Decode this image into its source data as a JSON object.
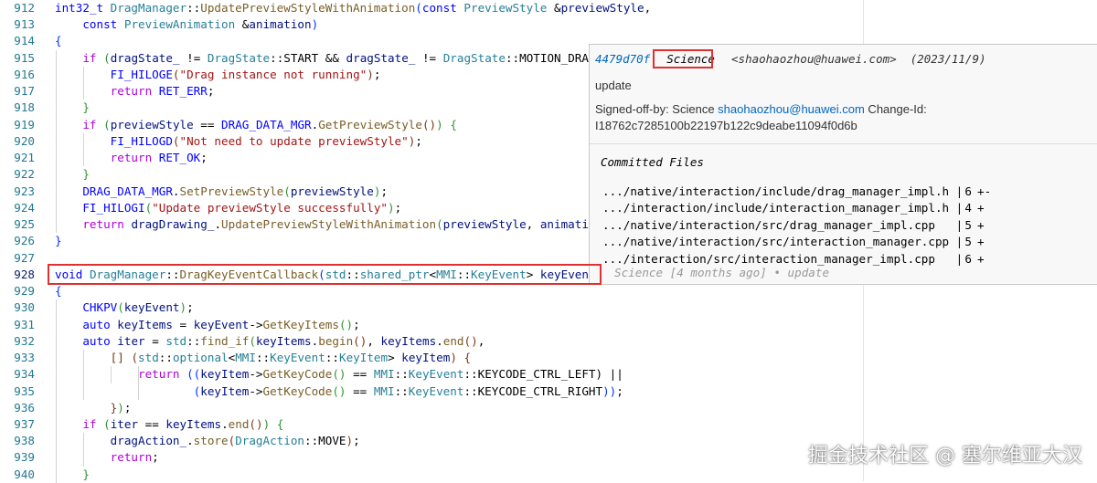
{
  "editor": {
    "lines": [
      {
        "n": "912",
        "tokens": [
          [
            "t-kw",
            "int32_t"
          ],
          [
            "t-plain",
            " "
          ],
          [
            "t-type",
            "DragManager"
          ],
          [
            "t-plain",
            "::"
          ],
          [
            "t-fn",
            "UpdatePreviewStyleWithAnimation"
          ],
          [
            "t-br1",
            "("
          ],
          [
            "t-kw",
            "const"
          ],
          [
            "t-plain",
            " "
          ],
          [
            "t-type",
            "PreviewStyle"
          ],
          [
            "t-plain",
            " &"
          ],
          [
            "t-var",
            "previewStyle"
          ],
          [
            "t-plain",
            ","
          ]
        ]
      },
      {
        "n": "913",
        "tokens": [
          [
            "t-plain",
            "    "
          ],
          [
            "t-kw",
            "const"
          ],
          [
            "t-plain",
            " "
          ],
          [
            "t-type",
            "PreviewAnimation"
          ],
          [
            "t-plain",
            " &"
          ],
          [
            "t-var",
            "animation"
          ],
          [
            "t-br1",
            ")"
          ]
        ]
      },
      {
        "n": "914",
        "tokens": [
          [
            "t-br1",
            "{"
          ]
        ]
      },
      {
        "n": "915",
        "tokens": [
          [
            "t-plain",
            "    "
          ],
          [
            "t-ctrl",
            "if"
          ],
          [
            "t-plain",
            " "
          ],
          [
            "t-br2",
            "("
          ],
          [
            "t-var",
            "dragState_"
          ],
          [
            "t-plain",
            " != "
          ],
          [
            "t-type",
            "DragState"
          ],
          [
            "t-plain",
            "::START && "
          ],
          [
            "t-var",
            "dragState_"
          ],
          [
            "t-plain",
            " != "
          ],
          [
            "t-type",
            "DragState"
          ],
          [
            "t-plain",
            "::MOTION_DRAGG"
          ]
        ]
      },
      {
        "n": "916",
        "tokens": [
          [
            "t-plain",
            "        "
          ],
          [
            "t-macro",
            "FI_HILOGE"
          ],
          [
            "t-br3",
            "("
          ],
          [
            "t-str",
            "\"Drag instance not running\""
          ],
          [
            "t-br3",
            ")"
          ],
          [
            "t-plain",
            ";"
          ]
        ]
      },
      {
        "n": "917",
        "tokens": [
          [
            "t-plain",
            "        "
          ],
          [
            "t-ctrl",
            "return"
          ],
          [
            "t-plain",
            " "
          ],
          [
            "t-macro",
            "RET_ERR"
          ],
          [
            "t-plain",
            ";"
          ]
        ]
      },
      {
        "n": "918",
        "tokens": [
          [
            "t-plain",
            "    "
          ],
          [
            "t-br2",
            "}"
          ]
        ]
      },
      {
        "n": "919",
        "tokens": [
          [
            "t-plain",
            "    "
          ],
          [
            "t-ctrl",
            "if"
          ],
          [
            "t-plain",
            " "
          ],
          [
            "t-br2",
            "("
          ],
          [
            "t-var",
            "previewStyle"
          ],
          [
            "t-plain",
            " == "
          ],
          [
            "t-macro",
            "DRAG_DATA_MGR"
          ],
          [
            "t-plain",
            "."
          ],
          [
            "t-fn",
            "GetPreviewStyle"
          ],
          [
            "t-br3",
            "()"
          ],
          [
            "t-br2",
            ")"
          ],
          [
            "t-plain",
            " "
          ],
          [
            "t-br2",
            "{"
          ]
        ]
      },
      {
        "n": "920",
        "tokens": [
          [
            "t-plain",
            "        "
          ],
          [
            "t-macro",
            "FI_HILOGD"
          ],
          [
            "t-br3",
            "("
          ],
          [
            "t-str",
            "\"Not need to update previewStyle\""
          ],
          [
            "t-br3",
            ")"
          ],
          [
            "t-plain",
            ";"
          ]
        ]
      },
      {
        "n": "921",
        "tokens": [
          [
            "t-plain",
            "        "
          ],
          [
            "t-ctrl",
            "return"
          ],
          [
            "t-plain",
            " "
          ],
          [
            "t-macro",
            "RET_OK"
          ],
          [
            "t-plain",
            ";"
          ]
        ]
      },
      {
        "n": "922",
        "tokens": [
          [
            "t-plain",
            "    "
          ],
          [
            "t-br2",
            "}"
          ]
        ]
      },
      {
        "n": "923",
        "tokens": [
          [
            "t-plain",
            "    "
          ],
          [
            "t-macro",
            "DRAG_DATA_MGR"
          ],
          [
            "t-plain",
            "."
          ],
          [
            "t-fn",
            "SetPreviewStyle"
          ],
          [
            "t-br2",
            "("
          ],
          [
            "t-var",
            "previewStyle"
          ],
          [
            "t-br2",
            ")"
          ],
          [
            "t-plain",
            ";"
          ]
        ]
      },
      {
        "n": "924",
        "tokens": [
          [
            "t-plain",
            "    "
          ],
          [
            "t-macro",
            "FI_HILOGI"
          ],
          [
            "t-br2",
            "("
          ],
          [
            "t-str",
            "\"Update previewStyle successfully\""
          ],
          [
            "t-br2",
            ")"
          ],
          [
            "t-plain",
            ";"
          ]
        ]
      },
      {
        "n": "925",
        "tokens": [
          [
            "t-plain",
            "    "
          ],
          [
            "t-ctrl",
            "return"
          ],
          [
            "t-plain",
            " "
          ],
          [
            "t-var",
            "dragDrawing_"
          ],
          [
            "t-plain",
            "."
          ],
          [
            "t-fn",
            "UpdatePreviewStyleWithAnimation"
          ],
          [
            "t-br2",
            "("
          ],
          [
            "t-var",
            "previewStyle"
          ],
          [
            "t-plain",
            ", "
          ],
          [
            "t-var",
            "animation"
          ]
        ]
      },
      {
        "n": "926",
        "tokens": [
          [
            "t-br1",
            "}"
          ]
        ]
      },
      {
        "n": "927",
        "tokens": []
      },
      {
        "n": "928",
        "active": true,
        "tokens": [
          [
            "t-kw",
            "void"
          ],
          [
            "t-plain",
            " "
          ],
          [
            "t-type",
            "DragManager"
          ],
          [
            "t-plain",
            "::"
          ],
          [
            "t-fn",
            "DragKeyEventCallback"
          ],
          [
            "t-br1",
            "("
          ],
          [
            "t-type",
            "std"
          ],
          [
            "t-plain",
            "::"
          ],
          [
            "t-type",
            "shared_ptr"
          ],
          [
            "t-plain",
            "<"
          ],
          [
            "t-type",
            "MMI"
          ],
          [
            "t-plain",
            "::"
          ],
          [
            "t-type",
            "KeyEvent"
          ],
          [
            "t-plain",
            "> "
          ],
          [
            "t-var",
            "keyEvent"
          ],
          [
            "t-br1",
            ")"
          ]
        ]
      },
      {
        "n": "929",
        "tokens": [
          [
            "t-br1",
            "{"
          ]
        ]
      },
      {
        "n": "930",
        "tokens": [
          [
            "t-plain",
            "    "
          ],
          [
            "t-macro",
            "CHKPV"
          ],
          [
            "t-br2",
            "("
          ],
          [
            "t-var",
            "keyEvent"
          ],
          [
            "t-br2",
            ")"
          ],
          [
            "t-plain",
            ";"
          ]
        ]
      },
      {
        "n": "931",
        "tokens": [
          [
            "t-plain",
            "    "
          ],
          [
            "t-kw",
            "auto"
          ],
          [
            "t-plain",
            " "
          ],
          [
            "t-var",
            "keyItems"
          ],
          [
            "t-plain",
            " = "
          ],
          [
            "t-var",
            "keyEvent"
          ],
          [
            "t-plain",
            "->"
          ],
          [
            "t-fn",
            "GetKeyItems"
          ],
          [
            "t-br2",
            "()"
          ],
          [
            "t-plain",
            ";"
          ]
        ]
      },
      {
        "n": "932",
        "tokens": [
          [
            "t-plain",
            "    "
          ],
          [
            "t-kw",
            "auto"
          ],
          [
            "t-plain",
            " "
          ],
          [
            "t-var",
            "iter"
          ],
          [
            "t-plain",
            " = "
          ],
          [
            "t-type",
            "std"
          ],
          [
            "t-plain",
            "::"
          ],
          [
            "t-fn",
            "find_if"
          ],
          [
            "t-br2",
            "("
          ],
          [
            "t-var",
            "keyItems"
          ],
          [
            "t-plain",
            "."
          ],
          [
            "t-fn",
            "begin"
          ],
          [
            "t-br3",
            "()"
          ],
          [
            "t-plain",
            ", "
          ],
          [
            "t-var",
            "keyItems"
          ],
          [
            "t-plain",
            "."
          ],
          [
            "t-fn",
            "end"
          ],
          [
            "t-br3",
            "()"
          ],
          [
            "t-plain",
            ","
          ]
        ]
      },
      {
        "n": "933",
        "tokens": [
          [
            "t-plain",
            "        "
          ],
          [
            "t-br3",
            "[]"
          ],
          [
            "t-plain",
            " "
          ],
          [
            "t-br3",
            "("
          ],
          [
            "t-type",
            "std"
          ],
          [
            "t-plain",
            "::"
          ],
          [
            "t-type",
            "optional"
          ],
          [
            "t-plain",
            "<"
          ],
          [
            "t-type",
            "MMI"
          ],
          [
            "t-plain",
            "::"
          ],
          [
            "t-type",
            "KeyEvent"
          ],
          [
            "t-plain",
            "::"
          ],
          [
            "t-type",
            "KeyItem"
          ],
          [
            "t-plain",
            "> "
          ],
          [
            "t-var",
            "keyItem"
          ],
          [
            "t-br3",
            ")"
          ],
          [
            "t-plain",
            " "
          ],
          [
            "t-br3",
            "{"
          ]
        ]
      },
      {
        "n": "934",
        "tokens": [
          [
            "t-plain",
            "            "
          ],
          [
            "t-ctrl",
            "return"
          ],
          [
            "t-plain",
            " "
          ],
          [
            "t-br1",
            "(("
          ],
          [
            "t-var",
            "keyItem"
          ],
          [
            "t-plain",
            "->"
          ],
          [
            "t-fn",
            "GetKeyCode"
          ],
          [
            "t-br2",
            "()"
          ],
          [
            "t-plain",
            " == "
          ],
          [
            "t-type",
            "MMI"
          ],
          [
            "t-plain",
            "::"
          ],
          [
            "t-type",
            "KeyEvent"
          ],
          [
            "t-plain",
            "::KEYCODE_CTRL_LEFT) ||"
          ]
        ]
      },
      {
        "n": "935",
        "tokens": [
          [
            "t-plain",
            "                    "
          ],
          [
            "t-br1",
            "("
          ],
          [
            "t-var",
            "keyItem"
          ],
          [
            "t-plain",
            "->"
          ],
          [
            "t-fn",
            "GetKeyCode"
          ],
          [
            "t-br2",
            "()"
          ],
          [
            "t-plain",
            " == "
          ],
          [
            "t-type",
            "MMI"
          ],
          [
            "t-plain",
            "::"
          ],
          [
            "t-type",
            "KeyEvent"
          ],
          [
            "t-plain",
            "::KEYCODE_CTRL_RIGHT"
          ],
          [
            "t-br1",
            "))"
          ],
          [
            "t-plain",
            ";"
          ]
        ]
      },
      {
        "n": "936",
        "tokens": [
          [
            "t-plain",
            "        "
          ],
          [
            "t-br3",
            "}"
          ],
          [
            "t-br2",
            ")"
          ],
          [
            "t-plain",
            ";"
          ]
        ]
      },
      {
        "n": "937",
        "tokens": [
          [
            "t-plain",
            "    "
          ],
          [
            "t-ctrl",
            "if"
          ],
          [
            "t-plain",
            " "
          ],
          [
            "t-br2",
            "("
          ],
          [
            "t-var",
            "iter"
          ],
          [
            "t-plain",
            " == "
          ],
          [
            "t-var",
            "keyItems"
          ],
          [
            "t-plain",
            "."
          ],
          [
            "t-fn",
            "end"
          ],
          [
            "t-br3",
            "()"
          ],
          [
            "t-br2",
            ")"
          ],
          [
            "t-plain",
            " "
          ],
          [
            "t-br2",
            "{"
          ]
        ]
      },
      {
        "n": "938",
        "tokens": [
          [
            "t-plain",
            "        "
          ],
          [
            "t-var",
            "dragAction_"
          ],
          [
            "t-plain",
            "."
          ],
          [
            "t-fn",
            "store"
          ],
          [
            "t-br3",
            "("
          ],
          [
            "t-type",
            "DragAction"
          ],
          [
            "t-plain",
            "::MOVE"
          ],
          [
            "t-br3",
            ")"
          ],
          [
            "t-plain",
            ";"
          ]
        ]
      },
      {
        "n": "939",
        "tokens": [
          [
            "t-plain",
            "        "
          ],
          [
            "t-ctrl",
            "return"
          ],
          [
            "t-plain",
            ";"
          ]
        ]
      },
      {
        "n": "940",
        "tokens": [
          [
            "t-plain",
            "    "
          ],
          [
            "t-br2",
            "}"
          ]
        ]
      }
    ]
  },
  "hover": {
    "hash": "4479d70f",
    "author": "Science",
    "email": "<shaohaozhou@huawei.com>",
    "date": "(2023/11/9)",
    "message": "update",
    "signed_off_prefix": "Signed-off-by: Science ",
    "signed_off_email": "shaohaozhou@huawei.com",
    "change_id_label": " Change-Id:",
    "change_id": "I18762c7285100b22197b122c9deabe11094f0d6b",
    "committed_files_title": "Committed Files",
    "files": [
      {
        "path": ".../native/interaction/include/drag_manager_impl.h |",
        "count": "6",
        "delta": "+-"
      },
      {
        "path": ".../interaction/include/interaction_manager_impl.h |",
        "count": "4",
        "delta": "+"
      },
      {
        "path": ".../native/interaction/src/drag_manager_impl.cpp   |",
        "count": "5",
        "delta": "+"
      },
      {
        "path": ".../native/interaction/src/interaction_manager.cpp |",
        "count": "5",
        "delta": "+"
      },
      {
        "path": ".../interaction/src/interaction_manager_impl.cpp   |",
        "count": "6",
        "delta": "+"
      }
    ]
  },
  "inline_blame": "Science [4 months ago] • update",
  "watermark": "掘金技术社区 @ 塞尔维亚大汉",
  "colors": {
    "line_number": "#237893",
    "highlight_border": "#e03030",
    "hash_link": "#0066bf"
  }
}
